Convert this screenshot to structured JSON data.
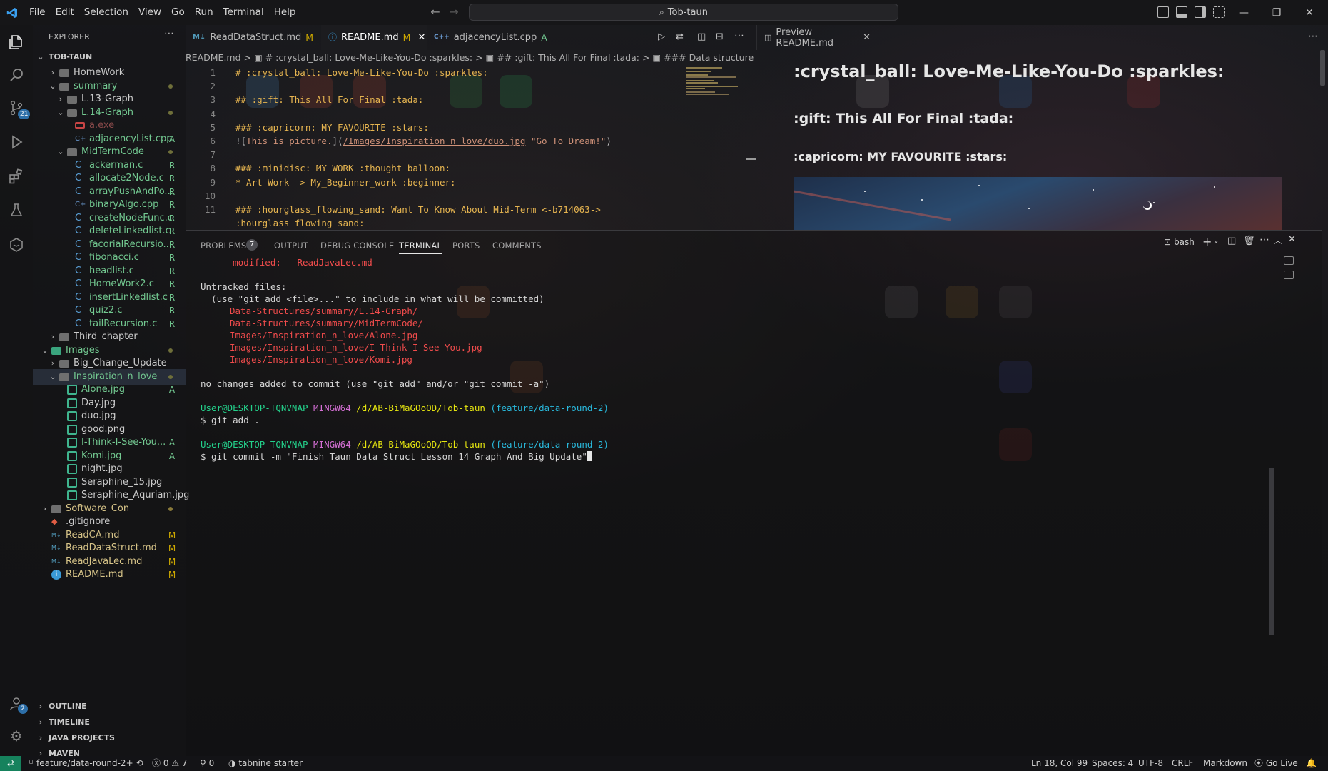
{
  "title_bar": {
    "menu": [
      "File",
      "Edit",
      "Selection",
      "View",
      "Go",
      "Run",
      "Terminal",
      "Help"
    ],
    "search": "Tob-taun"
  },
  "activity_bar": {
    "source_control_badge": "21",
    "accounts_badge": "2"
  },
  "explorer": {
    "header": "EXPLORER",
    "root": "TOB-TAUN",
    "rows": [
      {
        "label": "HomeWork",
        "type": "folder",
        "depth": 1,
        "arrow": "›",
        "status": ""
      },
      {
        "label": "summary",
        "type": "folder",
        "depth": 1,
        "arrow": "⌄",
        "status": "dot"
      },
      {
        "label": "L.13-Graph",
        "type": "folder",
        "depth": 2,
        "arrow": "›",
        "status": ""
      },
      {
        "label": "L.14-Graph",
        "type": "folder",
        "depth": 2,
        "arrow": "⌄",
        "status": "dot"
      },
      {
        "label": "a.exe",
        "type": "exe",
        "depth": 3,
        "arrow": "",
        "status": ""
      },
      {
        "label": "adjacencyList.cpp",
        "type": "cpp",
        "depth": 3,
        "arrow": "",
        "status": "A"
      },
      {
        "label": "MidTermCode",
        "type": "folder",
        "depth": 2,
        "arrow": "⌄",
        "status": "dot"
      },
      {
        "label": "ackerman.c",
        "type": "c",
        "depth": 3,
        "arrow": "",
        "status": "R"
      },
      {
        "label": "allocate2Node.c",
        "type": "c",
        "depth": 3,
        "arrow": "",
        "status": "R"
      },
      {
        "label": "arrayPushAndPo...",
        "type": "c",
        "depth": 3,
        "arrow": "",
        "status": "R"
      },
      {
        "label": "binaryAlgo.cpp",
        "type": "cpp",
        "depth": 3,
        "arrow": "",
        "status": "R"
      },
      {
        "label": "createNodeFunc.c",
        "type": "c",
        "depth": 3,
        "arrow": "",
        "status": "R"
      },
      {
        "label": "deleteLinkedlist.c",
        "type": "c",
        "depth": 3,
        "arrow": "",
        "status": "R"
      },
      {
        "label": "facorialRecursio...",
        "type": "c",
        "depth": 3,
        "arrow": "",
        "status": "R"
      },
      {
        "label": "fibonacci.c",
        "type": "c",
        "depth": 3,
        "arrow": "",
        "status": "R"
      },
      {
        "label": "headlist.c",
        "type": "c",
        "depth": 3,
        "arrow": "",
        "status": "R"
      },
      {
        "label": "HomeWork2.c",
        "type": "c",
        "depth": 3,
        "arrow": "",
        "status": "R"
      },
      {
        "label": "insertLinkedlist.c",
        "type": "c",
        "depth": 3,
        "arrow": "",
        "status": "R"
      },
      {
        "label": "quiz2.c",
        "type": "c",
        "depth": 3,
        "arrow": "",
        "status": "R"
      },
      {
        "label": "tailRecursion.c",
        "type": "c",
        "depth": 3,
        "arrow": "",
        "status": "R"
      },
      {
        "label": "Third_chapter",
        "type": "folder",
        "depth": 1,
        "arrow": "›",
        "status": ""
      },
      {
        "label": "Images",
        "type": "imgfolder",
        "depth": 0,
        "arrow": "⌄",
        "status": "dot"
      },
      {
        "label": "Big_Change_Update",
        "type": "folder",
        "depth": 1,
        "arrow": "›",
        "status": ""
      },
      {
        "label": "Inspiration_n_love",
        "type": "folder",
        "depth": 1,
        "arrow": "⌄",
        "status": "dot"
      },
      {
        "label": "Alone.jpg",
        "type": "img",
        "depth": 2,
        "arrow": "",
        "status": "A"
      },
      {
        "label": "Day.jpg",
        "type": "img",
        "depth": 2,
        "arrow": "",
        "status": ""
      },
      {
        "label": "duo.jpg",
        "type": "img",
        "depth": 2,
        "arrow": "",
        "status": ""
      },
      {
        "label": "good.png",
        "type": "img",
        "depth": 2,
        "arrow": "",
        "status": ""
      },
      {
        "label": "I-Think-I-See-You...",
        "type": "img",
        "depth": 2,
        "arrow": "",
        "status": "A"
      },
      {
        "label": "Komi.jpg",
        "type": "img",
        "depth": 2,
        "arrow": "",
        "status": "A"
      },
      {
        "label": "night.jpg",
        "type": "img",
        "depth": 2,
        "arrow": "",
        "status": ""
      },
      {
        "label": "Seraphine_15.jpg",
        "type": "img",
        "depth": 2,
        "arrow": "",
        "status": ""
      },
      {
        "label": "Seraphine_Aquriam.jpg",
        "type": "img",
        "depth": 2,
        "arrow": "",
        "status": ""
      },
      {
        "label": "Software_Con",
        "type": "folder",
        "depth": 0,
        "arrow": "›",
        "status": "dotyellow"
      },
      {
        "label": ".gitignore",
        "type": "git",
        "depth": 0,
        "arrow": "",
        "status": ""
      },
      {
        "label": "ReadCA.md",
        "type": "md",
        "depth": 0,
        "arrow": "",
        "status": "M"
      },
      {
        "label": "ReadDataStruct.md",
        "type": "md",
        "depth": 0,
        "arrow": "",
        "status": "M"
      },
      {
        "label": "ReadJavaLec.md",
        "type": "md",
        "depth": 0,
        "arrow": "",
        "status": "M"
      },
      {
        "label": "README.md",
        "type": "info",
        "depth": 0,
        "arrow": "",
        "status": "M"
      }
    ],
    "sections": [
      "OUTLINE",
      "TIMELINE",
      "JAVA PROJECTS",
      "MAVEN"
    ]
  },
  "editor_tabs": [
    {
      "label": "ReadDataStruct.md",
      "status": "M",
      "icon": "M↓",
      "active": false
    },
    {
      "label": "README.md",
      "status": "M",
      "icon": "ⓘ",
      "active": true
    },
    {
      "label": "adjacencyList.cpp",
      "status": "A",
      "icon": "C++",
      "active": false
    }
  ],
  "breadcrumb": "README.md  >  ▣ # :crystal_ball: Love-Me-Like-You-Do :sparkles:  >  ▣ ## :gift: This All For Final :tada:  >  ▣ ### Data structure :zzz:",
  "editor_lines": [
    {
      "n": "1",
      "code": "# :crystal_ball: Love-Me-Like-You-Do :sparkles:"
    },
    {
      "n": "2",
      "code": ""
    },
    {
      "n": "3",
      "code": "## :gift: This All For Final :tada:"
    },
    {
      "n": "4",
      "code": ""
    },
    {
      "n": "5",
      "code": "### :capricorn: MY FAVOURITE :stars:"
    },
    {
      "n": "6",
      "code": "![This is picture.](/Images/Inspiration_n_love/duo.jpg \"Go To Dream!\")"
    },
    {
      "n": "7",
      "code": ""
    },
    {
      "n": "8",
      "code": "### :minidisc: MY WORK :thought_balloon:"
    },
    {
      "n": "9",
      "code": "* Art-Work -> My_Beginner_work :beginner:"
    },
    {
      "n": "10",
      "code": ""
    },
    {
      "n": "11",
      "code": "### :hourglass_flowing_sand: Want To Know About Mid-Term <-b714063->"
    },
    {
      "n": "",
      "code": ":hourglass_flowing_sand:"
    }
  ],
  "preview": {
    "tab": "Preview README.md",
    "h1": ":crystal_ball: Love-Me-Like-You-Do :sparkles:",
    "h2": ":gift: This All For Final :tada:",
    "h3": ":capricorn: MY FAVOURITE :stars:"
  },
  "panel": {
    "tabs": [
      "PROBLEMS",
      "OUTPUT",
      "DEBUG CONSOLE",
      "TERMINAL",
      "PORTS",
      "COMMENTS"
    ],
    "problems_count": "7",
    "shell": "bash"
  },
  "terminal": {
    "modified_label": "modified:",
    "modified_file": "ReadJavaLec.md",
    "untracked": "Untracked files:",
    "hint": "  (use \"git add <file>...\" to include in what will be committed)",
    "files": [
      "Data-Structures/summary/L.14-Graph/",
      "Data-Structures/summary/MidTermCode/",
      "Images/Inspiration_n_love/Alone.jpg",
      "Images/Inspiration_n_love/I-Think-I-See-You.jpg",
      "Images/Inspiration_n_love/Komi.jpg"
    ],
    "no_changes": "no changes added to commit (use \"git add\" and/or \"git commit -a\")",
    "user": "User@DESKTOP-TQNVNAP",
    "mingw": "MINGW64",
    "path": "/d/AB-BiMaGOoOD/Tob-taun",
    "branch": "(feature/data-round-2)",
    "cmd1": "$ git add .",
    "cmd2": "$ git commit -m \"Finish Taun Data Struct Lesson 14 Graph And Big Update\""
  },
  "status_bar": {
    "branch": "feature/data-round-2+",
    "errors": "0",
    "warnings": "7",
    "ports": "0",
    "tabnine": "tabnine starter",
    "position": "Ln 18, Col 99",
    "spaces": "Spaces: 4",
    "encoding": "UTF-8",
    "eol": "CRLF",
    "language": "Markdown",
    "golive": "Go Live"
  }
}
